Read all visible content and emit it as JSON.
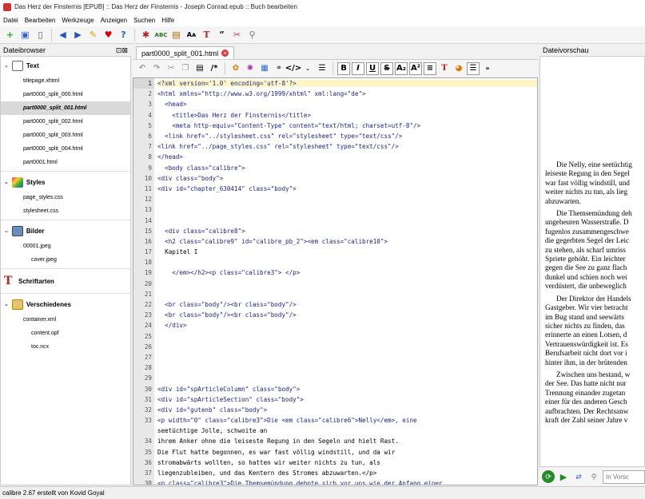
{
  "title": "Das Herz der Finsternis [EPUB] :: Das Herz der Finsternis - Joseph Conrad.epub :: Buch bearbeiten",
  "menu": [
    "Datei",
    "Bearbeiten",
    "Werkzeuge",
    "Anzeigen",
    "Suchen",
    "Hilfe"
  ],
  "toolbar_icons": [
    "new-file-icon",
    "save-icon",
    "device-icon",
    "back-icon",
    "forward-icon",
    "fix-icon",
    "favorite-icon",
    "help-icon",
    "bug-icon",
    "spellcheck-icon",
    "reports-icon",
    "case-icon",
    "fonts-icon",
    "quote-icon",
    "cut-icon",
    "zoom-icon"
  ],
  "filebrowser": {
    "title": "Dateibrowser",
    "text": {
      "label": "Text",
      "files": [
        "titlepage.xhtml",
        "part0000_split_000.html",
        "part0000_split_001.html",
        "part0000_split_002.html",
        "part0000_split_003.html",
        "part0000_split_004.html",
        "part0001.html"
      ],
      "selected": 1
    },
    "styles": {
      "label": "Styles",
      "files": [
        "page_styles.css",
        "stylesheet.css"
      ]
    },
    "images": {
      "label": "Bilder",
      "files": [
        "00001.jpeg",
        "cover.jpeg"
      ]
    },
    "fonts": {
      "label": "Schriftarten"
    },
    "misc": {
      "label": "Verschiedenes",
      "files": [
        "container.xml",
        "content.opf",
        "toc.ncx"
      ]
    }
  },
  "editor": {
    "tab": "part0000_split_001.html",
    "lines": [
      {
        "n": "1",
        "c": "<?xml version='1.0' encoding='utf-8'?>",
        "cur": true
      },
      {
        "n": "2",
        "c": "<html xmlns=\"http://www.w3.org/1999/xhtml\" xml:lang=\"de\">"
      },
      {
        "n": "3",
        "c": "  <head>"
      },
      {
        "n": "4",
        "c": "    <title>Das Herz der Finsternis</title>"
      },
      {
        "n": "5",
        "c": "    <meta http-equiv=\"Content-Type\" content=\"text/html; charset=utf-8\"/>"
      },
      {
        "n": "6",
        "c": "  <link href=\"../stylesheet.css\" rel=\"stylesheet\" type=\"text/css\"/>"
      },
      {
        "n": "7",
        "c": "<link href=\"../page_styles.css\" rel=\"stylesheet\" type=\"text/css\"/>"
      },
      {
        "n": "8",
        "c": "</head>"
      },
      {
        "n": "9",
        "c": "  <body class=\"calibre\">"
      },
      {
        "n": "10",
        "c": "<div class=\"body\">"
      },
      {
        "n": "11",
        "c": "<div id=\"chapter_630414\" class=\"body\">"
      },
      {
        "n": "12",
        "c": ""
      },
      {
        "n": "13",
        "c": ""
      },
      {
        "n": "14",
        "c": ""
      },
      {
        "n": "15",
        "c": "  <div class=\"calibre8\">"
      },
      {
        "n": "16",
        "c": "  <h2 class=\"calibre9\" id=\"calibre_pb_2\"><em class=\"calibre10\">"
      },
      {
        "n": "17",
        "c": "  Kapitel I"
      },
      {
        "n": "18",
        "c": ""
      },
      {
        "n": "19",
        "c": "    </em></h2><p class=\"calibre3\"> </p>"
      },
      {
        "n": "20",
        "c": ""
      },
      {
        "n": "21",
        "c": ""
      },
      {
        "n": "22",
        "c": "  <br class=\"body\"/><br class=\"body\"/>"
      },
      {
        "n": "23",
        "c": "  <br class=\"body\"/><br class=\"body\"/>"
      },
      {
        "n": "24",
        "c": "  </div>"
      },
      {
        "n": "25",
        "c": ""
      },
      {
        "n": "26",
        "c": ""
      },
      {
        "n": "27",
        "c": ""
      },
      {
        "n": "28",
        "c": ""
      },
      {
        "n": "29",
        "c": ""
      },
      {
        "n": "30",
        "c": "<div id=\"spArticleColumn\" class=\"body\">"
      },
      {
        "n": "31",
        "c": "<div id=\"spArticleSection\" class=\"body\">"
      },
      {
        "n": "32",
        "c": "<div id=\"gutenb\" class=\"body\">"
      },
      {
        "n": "33",
        "c": "<p width=\"0\" class=\"calibre3\">Die <em class=\"calibre6\">Nelly</em>, eine"
      },
      {
        "n": "",
        "c": "seetüchtige Jolle, schwoite an"
      },
      {
        "n": "34",
        "c": "ihrem Anker ohne die leiseste Regung in den Segeln und hielt Rast."
      },
      {
        "n": "35",
        "c": "Die Flut hatte begonnen, es war fast völlig windstill, und da wir"
      },
      {
        "n": "36",
        "c": "stromabwärts wollten, so hatten wir weiter nichts zu tun, als"
      },
      {
        "n": "37",
        "c": "liegenzubleiben, und das Kentern des Stromes abzuwarten.</p>"
      },
      {
        "n": "38",
        "c": "<p class=\"calibre3\">Die Themsemündung dehnte sich vor uns wie der Anfang einer"
      },
      {
        "n": "39",
        "c": "ungeheuren Wasserstraße. Draußen waren die See und der Himmel"
      },
      {
        "n": "40",
        "c": "fugenlos zusammengeschweißt, und in dem leuchtenden Raum schienen"
      },
      {
        "n": "41",
        "c": "die gegerbten Segel der Leichter, die mit der Flut heraufkrieben,"
      }
    ]
  },
  "preview": {
    "title": "Dateivorschau",
    "paragraphs": [
      [
        "Die Nelly, eine seetüchtig",
        "leiseste Regung in den Segel",
        "war fast völlig windstill, und",
        "weiter nichts zu tun, als lieg",
        "abzuwarten."
      ],
      [
        "Die Themsemündung deh",
        "ungeheuren Wasserstraße. D",
        "fugenlos zusammengeschwe",
        "die gegerbten Segel der Leic",
        "zu stehen, als scharf umriss",
        "Spriete gehöht. Ein leichter",
        "gegen die See zu ganz flach",
        "dunkel und schien noch wei",
        "verdüstert, die unbeweglich"
      ],
      [
        "Der Direktor der Handels",
        "Gastgeber. Wir vier betracht",
        "im Bug stand und seewärts",
        "sicher nichts zu finden, das",
        "erinnerte an einen Lotsen, d",
        "Vertrauenswürdigkeit ist. Es",
        "Berufsarbeit nicht dort vor i",
        "hinter ihm, in der brütenden"
      ],
      [
        "Zwischen uns bestand, w",
        "der See. Das hatte nicht nur",
        "Trennung einander zugetan",
        "einer für des anderen Gesch",
        "aufbrachten. Der Rechtsanw",
        "kraft der Zahl seiner Jahre v"
      ]
    ],
    "search_placeholder": "In Vorsc"
  },
  "status": "calibre 2.67 erstellt von Kovid Goyal"
}
